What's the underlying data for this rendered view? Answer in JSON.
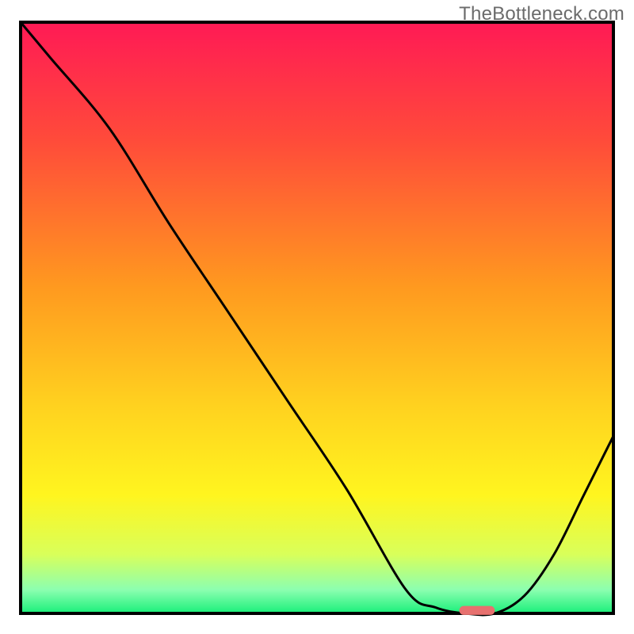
{
  "watermark": "TheBottleneck.com",
  "chart_data": {
    "type": "line",
    "title": "",
    "xlabel": "",
    "ylabel": "",
    "xlim": [
      0,
      100
    ],
    "ylim": [
      0,
      100
    ],
    "grid": false,
    "legend": false,
    "series": [
      {
        "name": "bottleneck-curve",
        "x": [
          0,
          5,
          15,
          25,
          35,
          45,
          55,
          65,
          70,
          75,
          80,
          85,
          90,
          95,
          100
        ],
        "values": [
          100,
          94,
          82,
          66,
          51,
          36,
          21,
          4,
          1,
          0,
          0,
          3,
          10,
          20,
          30
        ]
      }
    ],
    "marker": {
      "name": "optimal-marker",
      "x": 77,
      "y": 0.5,
      "width_pct": 6,
      "height_pct": 1.5,
      "color": "#e7716f"
    },
    "background": {
      "type": "vertical-gradient",
      "stops": [
        {
          "pos": 0.0,
          "color": "#ff1a55"
        },
        {
          "pos": 0.2,
          "color": "#ff4b3a"
        },
        {
          "pos": 0.45,
          "color": "#ff9a1f"
        },
        {
          "pos": 0.65,
          "color": "#ffd21f"
        },
        {
          "pos": 0.8,
          "color": "#fff51f"
        },
        {
          "pos": 0.9,
          "color": "#d9ff5a"
        },
        {
          "pos": 0.96,
          "color": "#8cffb0"
        },
        {
          "pos": 1.0,
          "color": "#19ef7a"
        }
      ]
    },
    "border_color": "#000000"
  }
}
